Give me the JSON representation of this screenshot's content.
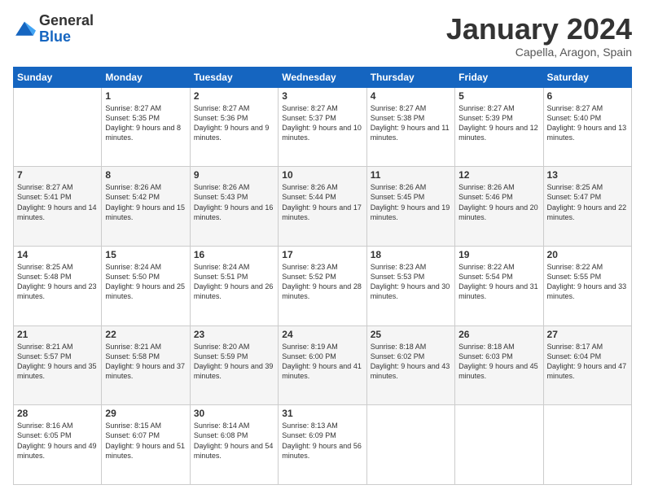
{
  "logo": {
    "general": "General",
    "blue": "Blue"
  },
  "header": {
    "title": "January 2024",
    "subtitle": "Capella, Aragon, Spain"
  },
  "weekdays": [
    "Sunday",
    "Monday",
    "Tuesday",
    "Wednesday",
    "Thursday",
    "Friday",
    "Saturday"
  ],
  "weeks": [
    [
      {
        "day": "",
        "sunrise": "",
        "sunset": "",
        "daylight": ""
      },
      {
        "day": "1",
        "sunrise": "Sunrise: 8:27 AM",
        "sunset": "Sunset: 5:35 PM",
        "daylight": "Daylight: 9 hours and 8 minutes."
      },
      {
        "day": "2",
        "sunrise": "Sunrise: 8:27 AM",
        "sunset": "Sunset: 5:36 PM",
        "daylight": "Daylight: 9 hours and 9 minutes."
      },
      {
        "day": "3",
        "sunrise": "Sunrise: 8:27 AM",
        "sunset": "Sunset: 5:37 PM",
        "daylight": "Daylight: 9 hours and 10 minutes."
      },
      {
        "day": "4",
        "sunrise": "Sunrise: 8:27 AM",
        "sunset": "Sunset: 5:38 PM",
        "daylight": "Daylight: 9 hours and 11 minutes."
      },
      {
        "day": "5",
        "sunrise": "Sunrise: 8:27 AM",
        "sunset": "Sunset: 5:39 PM",
        "daylight": "Daylight: 9 hours and 12 minutes."
      },
      {
        "day": "6",
        "sunrise": "Sunrise: 8:27 AM",
        "sunset": "Sunset: 5:40 PM",
        "daylight": "Daylight: 9 hours and 13 minutes."
      }
    ],
    [
      {
        "day": "7",
        "sunrise": "Sunrise: 8:27 AM",
        "sunset": "Sunset: 5:41 PM",
        "daylight": "Daylight: 9 hours and 14 minutes."
      },
      {
        "day": "8",
        "sunrise": "Sunrise: 8:26 AM",
        "sunset": "Sunset: 5:42 PM",
        "daylight": "Daylight: 9 hours and 15 minutes."
      },
      {
        "day": "9",
        "sunrise": "Sunrise: 8:26 AM",
        "sunset": "Sunset: 5:43 PM",
        "daylight": "Daylight: 9 hours and 16 minutes."
      },
      {
        "day": "10",
        "sunrise": "Sunrise: 8:26 AM",
        "sunset": "Sunset: 5:44 PM",
        "daylight": "Daylight: 9 hours and 17 minutes."
      },
      {
        "day": "11",
        "sunrise": "Sunrise: 8:26 AM",
        "sunset": "Sunset: 5:45 PM",
        "daylight": "Daylight: 9 hours and 19 minutes."
      },
      {
        "day": "12",
        "sunrise": "Sunrise: 8:26 AM",
        "sunset": "Sunset: 5:46 PM",
        "daylight": "Daylight: 9 hours and 20 minutes."
      },
      {
        "day": "13",
        "sunrise": "Sunrise: 8:25 AM",
        "sunset": "Sunset: 5:47 PM",
        "daylight": "Daylight: 9 hours and 22 minutes."
      }
    ],
    [
      {
        "day": "14",
        "sunrise": "Sunrise: 8:25 AM",
        "sunset": "Sunset: 5:48 PM",
        "daylight": "Daylight: 9 hours and 23 minutes."
      },
      {
        "day": "15",
        "sunrise": "Sunrise: 8:24 AM",
        "sunset": "Sunset: 5:50 PM",
        "daylight": "Daylight: 9 hours and 25 minutes."
      },
      {
        "day": "16",
        "sunrise": "Sunrise: 8:24 AM",
        "sunset": "Sunset: 5:51 PM",
        "daylight": "Daylight: 9 hours and 26 minutes."
      },
      {
        "day": "17",
        "sunrise": "Sunrise: 8:23 AM",
        "sunset": "Sunset: 5:52 PM",
        "daylight": "Daylight: 9 hours and 28 minutes."
      },
      {
        "day": "18",
        "sunrise": "Sunrise: 8:23 AM",
        "sunset": "Sunset: 5:53 PM",
        "daylight": "Daylight: 9 hours and 30 minutes."
      },
      {
        "day": "19",
        "sunrise": "Sunrise: 8:22 AM",
        "sunset": "Sunset: 5:54 PM",
        "daylight": "Daylight: 9 hours and 31 minutes."
      },
      {
        "day": "20",
        "sunrise": "Sunrise: 8:22 AM",
        "sunset": "Sunset: 5:55 PM",
        "daylight": "Daylight: 9 hours and 33 minutes."
      }
    ],
    [
      {
        "day": "21",
        "sunrise": "Sunrise: 8:21 AM",
        "sunset": "Sunset: 5:57 PM",
        "daylight": "Daylight: 9 hours and 35 minutes."
      },
      {
        "day": "22",
        "sunrise": "Sunrise: 8:21 AM",
        "sunset": "Sunset: 5:58 PM",
        "daylight": "Daylight: 9 hours and 37 minutes."
      },
      {
        "day": "23",
        "sunrise": "Sunrise: 8:20 AM",
        "sunset": "Sunset: 5:59 PM",
        "daylight": "Daylight: 9 hours and 39 minutes."
      },
      {
        "day": "24",
        "sunrise": "Sunrise: 8:19 AM",
        "sunset": "Sunset: 6:00 PM",
        "daylight": "Daylight: 9 hours and 41 minutes."
      },
      {
        "day": "25",
        "sunrise": "Sunrise: 8:18 AM",
        "sunset": "Sunset: 6:02 PM",
        "daylight": "Daylight: 9 hours and 43 minutes."
      },
      {
        "day": "26",
        "sunrise": "Sunrise: 8:18 AM",
        "sunset": "Sunset: 6:03 PM",
        "daylight": "Daylight: 9 hours and 45 minutes."
      },
      {
        "day": "27",
        "sunrise": "Sunrise: 8:17 AM",
        "sunset": "Sunset: 6:04 PM",
        "daylight": "Daylight: 9 hours and 47 minutes."
      }
    ],
    [
      {
        "day": "28",
        "sunrise": "Sunrise: 8:16 AM",
        "sunset": "Sunset: 6:05 PM",
        "daylight": "Daylight: 9 hours and 49 minutes."
      },
      {
        "day": "29",
        "sunrise": "Sunrise: 8:15 AM",
        "sunset": "Sunset: 6:07 PM",
        "daylight": "Daylight: 9 hours and 51 minutes."
      },
      {
        "day": "30",
        "sunrise": "Sunrise: 8:14 AM",
        "sunset": "Sunset: 6:08 PM",
        "daylight": "Daylight: 9 hours and 54 minutes."
      },
      {
        "day": "31",
        "sunrise": "Sunrise: 8:13 AM",
        "sunset": "Sunset: 6:09 PM",
        "daylight": "Daylight: 9 hours and 56 minutes."
      },
      {
        "day": "",
        "sunrise": "",
        "sunset": "",
        "daylight": ""
      },
      {
        "day": "",
        "sunrise": "",
        "sunset": "",
        "daylight": ""
      },
      {
        "day": "",
        "sunrise": "",
        "sunset": "",
        "daylight": ""
      }
    ]
  ]
}
